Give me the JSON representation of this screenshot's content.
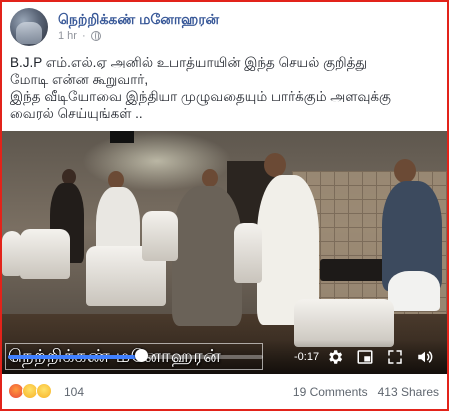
{
  "post": {
    "author": "நெற்றிக்கண் மனோஹரன்",
    "time": "1 hr",
    "caption_lines": [
      "B.J.P எம்.எல்.ஏ அனில் உபாத்யாயின் இந்த செயல் குறித்து",
      "மோடி என்ன கூறுவார்,",
      "இந்த வீடியோவை இந்தியா முழுவதையும் பார்க்கும் அளவுக்கு",
      "வைரல் செய்யுங்கள் .."
    ]
  },
  "video": {
    "watermark": "நெற்றிக்கண் மனோஹரன்",
    "time_remaining": "-0:17",
    "progress": 0.52,
    "icons": [
      "settings-icon",
      "pip-icon",
      "fullscreen-icon",
      "volume-icon"
    ]
  },
  "footer": {
    "reactions": [
      "angry",
      "haha",
      "sad"
    ],
    "reaction_count": "104",
    "comments": "19 Comments",
    "shares": "413 Shares"
  },
  "colors": {
    "border": "#e2231a",
    "author": "#385898",
    "progress": "#4080ff"
  }
}
